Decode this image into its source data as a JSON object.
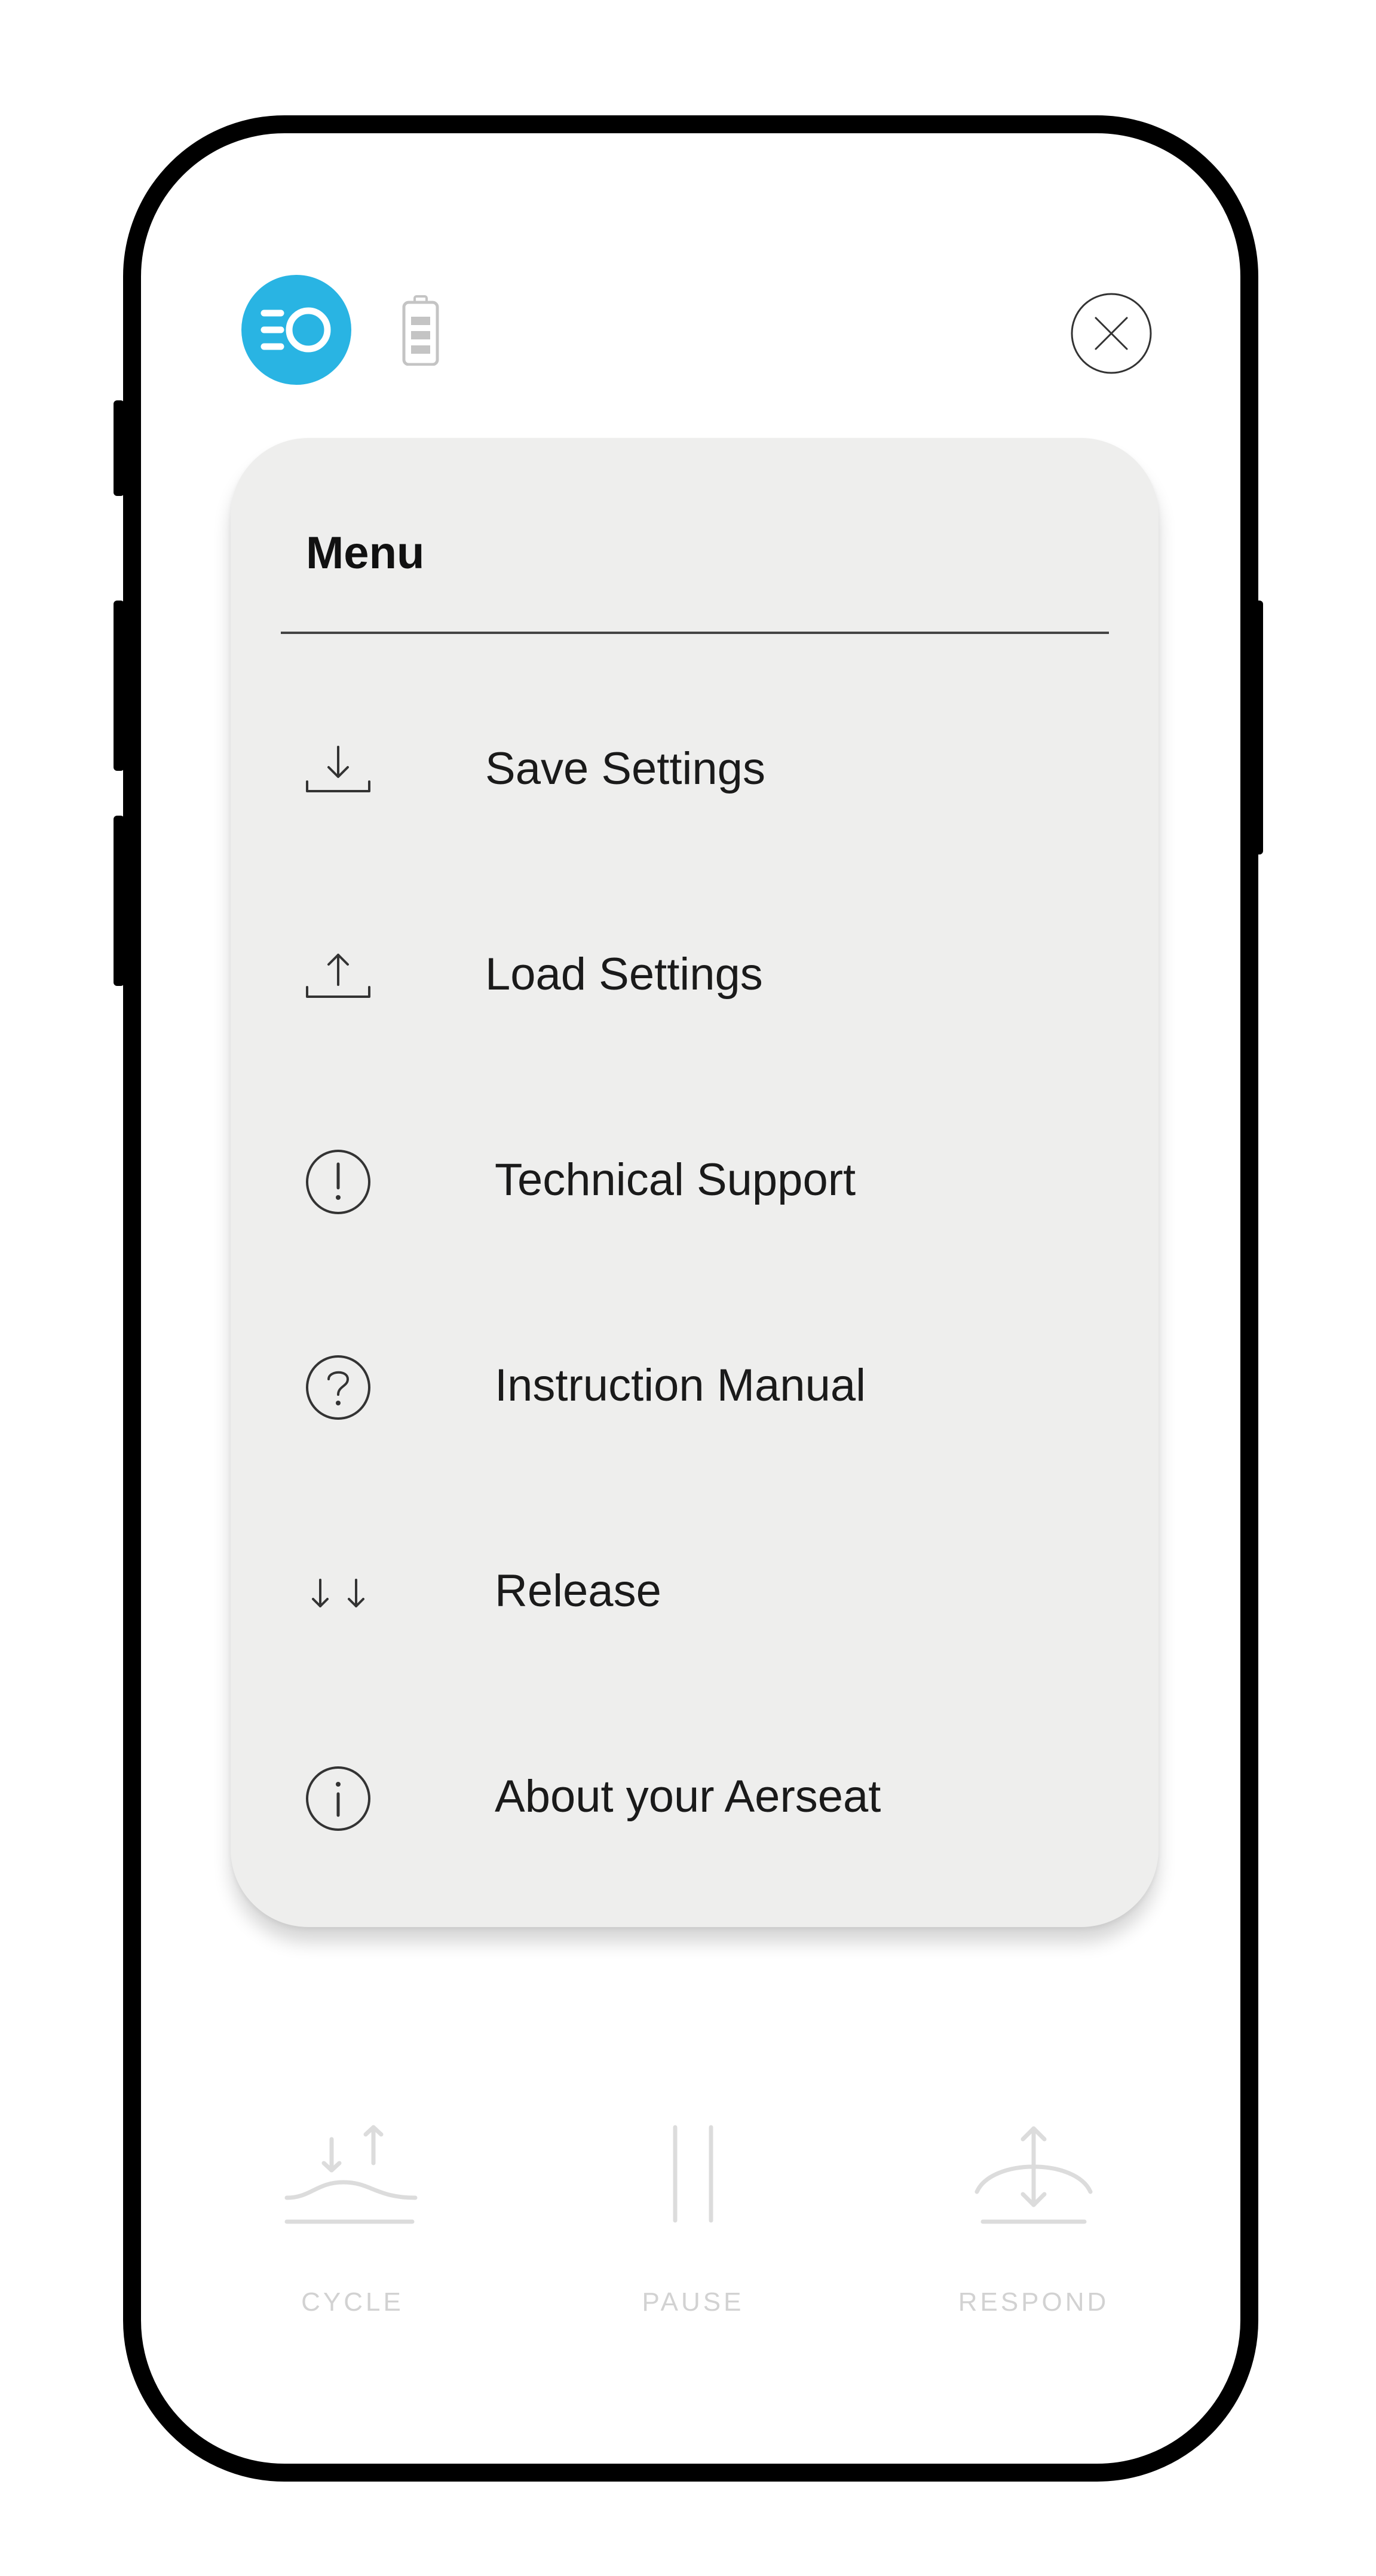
{
  "header": {
    "logo_icon": "aerseat-logo-icon",
    "battery_icon": "battery-icon",
    "close_icon": "close-icon",
    "accent_color": "#29b4e3"
  },
  "menu": {
    "title": "Menu",
    "items": [
      {
        "label": "Save Settings",
        "icon": "download-icon"
      },
      {
        "label": "Load Settings",
        "icon": "upload-icon"
      },
      {
        "label": "Technical Support",
        "icon": "exclamation-circle-icon"
      },
      {
        "label": "Instruction Manual",
        "icon": "question-circle-icon"
      },
      {
        "label": "Release",
        "icon": "double-down-arrow-icon"
      },
      {
        "label": "About your Aerseat",
        "icon": "info-circle-icon"
      }
    ]
  },
  "controls": [
    {
      "label": "CYCLE",
      "icon": "cycle-icon"
    },
    {
      "label": "PAUSE",
      "icon": "pause-icon"
    },
    {
      "label": "RESPOND",
      "icon": "respond-icon"
    }
  ]
}
